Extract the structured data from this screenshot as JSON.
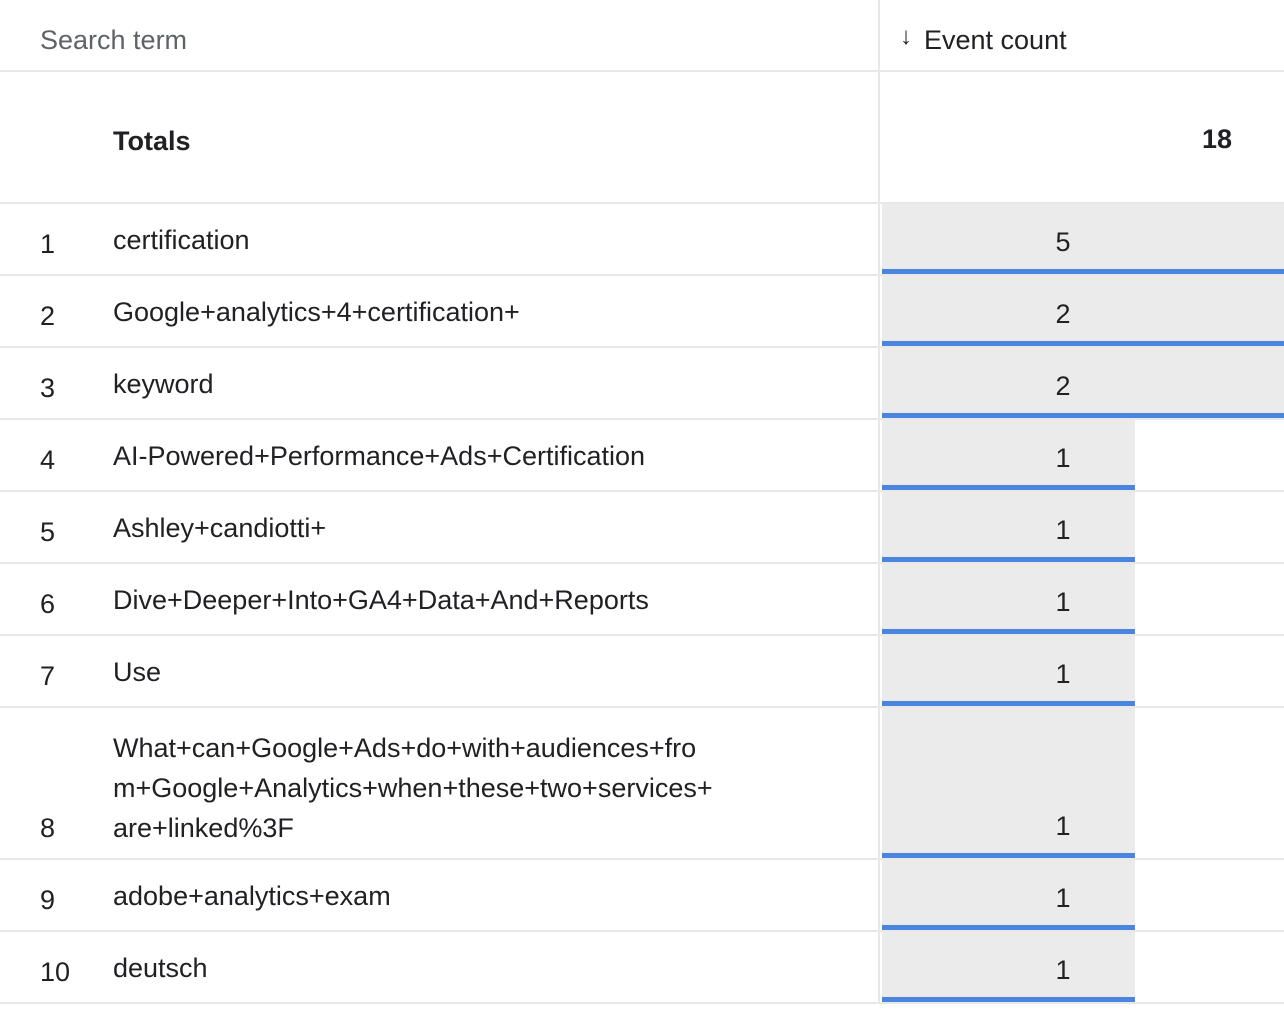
{
  "table": {
    "columns": {
      "term_label": "Search term",
      "sort_icon": "arrow-down-icon",
      "count_label": "Event count"
    },
    "totals": {
      "label": "Totals",
      "value": "18"
    },
    "rows": [
      {
        "index": "1",
        "term": "certification",
        "count": "5"
      },
      {
        "index": "2",
        "term": "Google+analytics+4+certification+",
        "count": "2"
      },
      {
        "index": "3",
        "term": "keyword",
        "count": "2"
      },
      {
        "index": "4",
        "term": "AI-Powered+Performance+Ads+Certification",
        "count": "1"
      },
      {
        "index": "5",
        "term": "Ashley+candiotti+",
        "count": "1"
      },
      {
        "index": "6",
        "term": "Dive+Deeper+Into+GA4+Data+And+Reports",
        "count": "1"
      },
      {
        "index": "7",
        "term": "Use",
        "count": "1"
      },
      {
        "index": "8",
        "term": "What+can+Google+Ads+do+with+audiences+from+Google+Analytics+when+these+two+services+are+linked%3F",
        "count": "1"
      },
      {
        "index": "9",
        "term": "adobe+analytics+exam",
        "count": "1"
      },
      {
        "index": "10",
        "term": "deutsch",
        "count": "1"
      }
    ],
    "colors": {
      "bar_fill": "#ebebeb",
      "bar_accent": "#4a86e0"
    }
  }
}
